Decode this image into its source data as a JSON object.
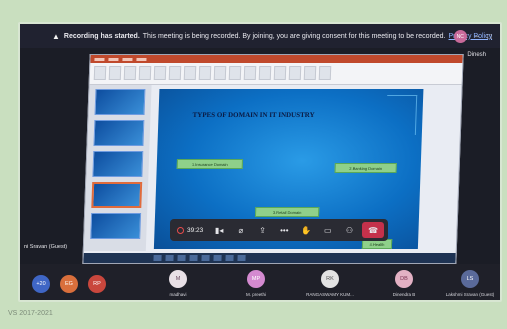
{
  "recording_bar": {
    "title": "Recording has started.",
    "message": "This meeting is being recorded. By joining, you are giving consent for this meeting to be recorded.",
    "policy_link": "Privacy Policy",
    "host_initials": "NC",
    "host_name": "Dinesh"
  },
  "slide": {
    "title": "TYPES OF DOMAIN IN IT INDUSTRY",
    "boxes": [
      "1.Insurance Domain",
      "2.Banking Domain",
      "3.Retail Domain",
      "4.Health"
    ]
  },
  "toolbar": {
    "timer": "39:23",
    "icons": [
      "record-icon",
      "camera-icon",
      "mic-off-icon",
      "share-icon",
      "more-icon",
      "raise-hand-icon",
      "chat-icon",
      "participants-icon",
      "leave-icon"
    ]
  },
  "guest_label": "ni Sravan (Guest)",
  "participants": [
    {
      "initials": "+20",
      "color": "#3f66c5",
      "name": ""
    },
    {
      "initials": "EG",
      "color": "#d96f3c",
      "name": ""
    },
    {
      "initials": "RP",
      "color": "#c9473d",
      "name": ""
    },
    {
      "initials": "M",
      "color": "#e8e0e6",
      "name": "madhavi"
    },
    {
      "initials": "MP",
      "color": "#d48ad0",
      "name": "M. preethi"
    },
    {
      "initials": "RK",
      "color": "#e3e3e3",
      "name": "RANGASWAMY KUM..."
    },
    {
      "initials": "DB",
      "color": "#e3b1c4",
      "name": "Dinendra B"
    },
    {
      "initials": "LS",
      "color": "#5a6a9a",
      "name": "Lakshmi Sravan (Guest)"
    }
  ],
  "footer": "VS 2017-2021"
}
